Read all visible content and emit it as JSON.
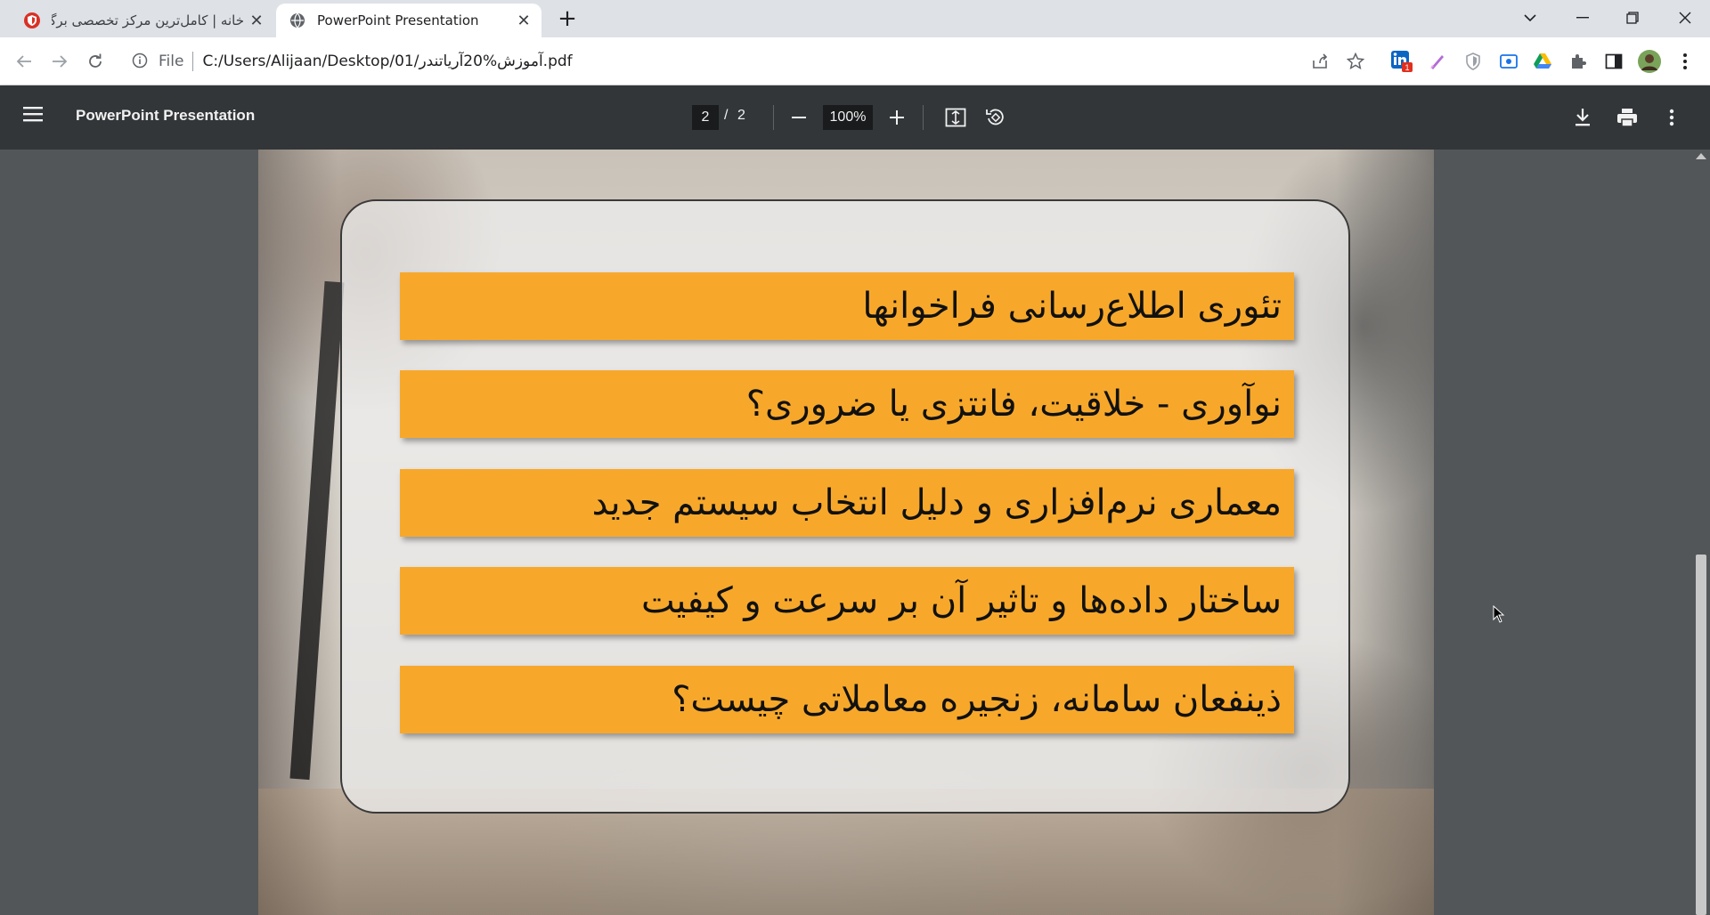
{
  "browser": {
    "tabs": [
      {
        "title": "خانه | کامل‌ترین مرکز تخصصی برگزاری دوره",
        "active": false,
        "icon": "shield-favicon-icon"
      },
      {
        "title": "PowerPoint Presentation",
        "active": true,
        "icon": "globe-icon"
      }
    ],
    "new_tab_label": "+",
    "address": {
      "scheme": "File",
      "url": "C:/Users/Alijaan/Desktop/01/آموزش%20آریاتندر.pdf"
    },
    "extension_badge": "1"
  },
  "pdf_viewer": {
    "title": "PowerPoint Presentation",
    "current_page": "2",
    "page_separator": "/",
    "total_pages": "2",
    "zoom": "100%"
  },
  "slide": {
    "items": [
      "تئوری اطلاع‌رسانی فراخوانها",
      "نوآوری - خلاقیت، فانتزی یا ضروری؟",
      "معماری نرم‌افزاری و دلیل انتخاب سیستم جدید",
      "ساختار داده‌ها و تاثیر آن بر سرعت و کیفیت",
      "ذینفعان سامانه، زنجیره معاملاتی چیست؟"
    ],
    "bar_color": "#f7a82b"
  },
  "colors": {
    "tabstrip": "#dee1e6",
    "pdf_toolbar": "#323639",
    "viewer_bg": "#525659"
  }
}
